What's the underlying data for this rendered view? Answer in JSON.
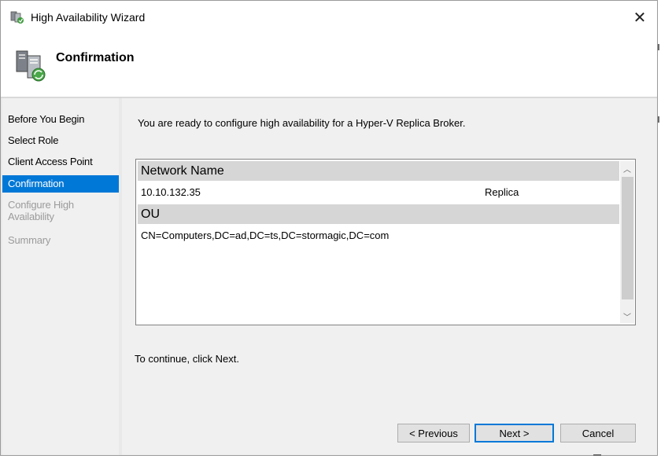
{
  "window": {
    "title": "High Availability Wizard",
    "close_glyph": "✕"
  },
  "header": {
    "title": "Confirmation"
  },
  "nav": {
    "items": [
      {
        "label": "Before You Begin",
        "state": "normal"
      },
      {
        "label": "Select Role",
        "state": "normal"
      },
      {
        "label": "Client Access Point",
        "state": "normal"
      },
      {
        "label": "Confirmation",
        "state": "active"
      },
      {
        "label": "Configure High Availability",
        "state": "disabled"
      },
      {
        "label": "Summary",
        "state": "disabled"
      }
    ]
  },
  "main": {
    "intro": "You are ready to configure high availability for a Hyper-V Replica Broker.",
    "groups": [
      {
        "header": "Network Name",
        "rows": [
          {
            "value": "10.10.132.35",
            "detail": "Replica"
          }
        ]
      },
      {
        "header": "OU",
        "rows": [
          {
            "value": "CN=Computers,DC=ad,DC=ts,DC=stormagic,DC=com",
            "detail": ""
          }
        ]
      }
    ],
    "continue_text": "To continue, click Next."
  },
  "buttons": {
    "previous": "< Previous",
    "next": "Next >",
    "cancel": "Cancel"
  },
  "colors": {
    "accent": "#0078d7",
    "panel": "#f0f0f0",
    "group_header": "#d6d6d6",
    "disabled_text": "#9b9b9b"
  },
  "icons": {
    "app": "cluster-wizard-icon",
    "header": "server-cluster-icon",
    "close": "close-icon"
  }
}
